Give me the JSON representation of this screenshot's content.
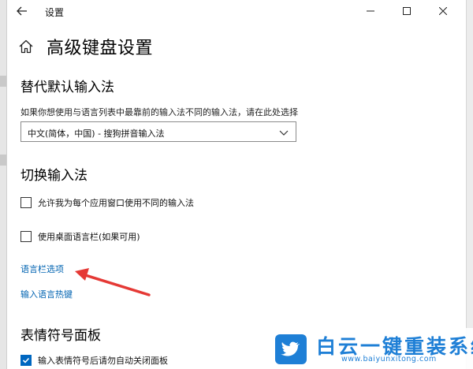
{
  "window": {
    "title": "设置",
    "back_icon": "back-arrow-icon",
    "controls": [
      "minimize-icon",
      "maximize-icon",
      "close-icon"
    ]
  },
  "header": {
    "icon": "home-icon",
    "title": "高级键盘设置"
  },
  "override_input": {
    "title": "替代默认输入法",
    "description": "如果你想使用与语言列表中最靠前的输入法不同的输入法，请在此处选择",
    "selected": "中文(简体，中国) - 搜狗拼音输入法"
  },
  "switch_input": {
    "title": "切换输入法",
    "options": [
      {
        "label": "允许我为每个应用窗口使用不同的输入法",
        "checked": false
      },
      {
        "label": "使用桌面语言栏(如果可用)",
        "checked": false
      }
    ],
    "links": [
      "语言栏选项",
      "输入语言热键"
    ]
  },
  "emoji_panel": {
    "title": "表情符号面板",
    "options": [
      {
        "label": "输入表情符号后请勿自动关闭面板",
        "checked": true
      }
    ]
  },
  "watermark": {
    "text": "白云一键重装系统",
    "url": "www.baiyunxitong.com"
  },
  "colors": {
    "link": "#0063b1",
    "accent": "#0067c0",
    "annotation_arrow": "#e53935",
    "watermark": "#1e7fd6"
  }
}
